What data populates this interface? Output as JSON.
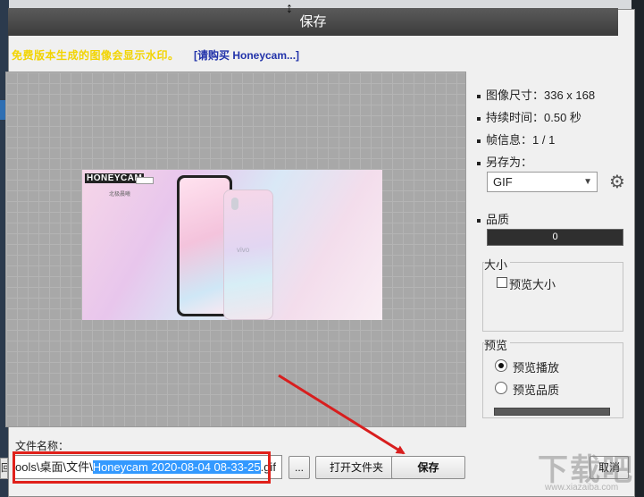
{
  "dialog": {
    "title": "保存",
    "notice": "免费版本生成的图像会显示水印。",
    "buy_link": "[请购买 Honeycam...]"
  },
  "preview": {
    "gif_logo": "HONEYCAM",
    "gif_subtitle": "北极晨曦",
    "phone_brand": "vivo"
  },
  "info": {
    "image_size": "图像尺寸：336 x 168",
    "duration": "持续时间：0.50 秒",
    "frame_info": "帧信息：1 / 1",
    "save_as_label": "另存为：",
    "format_value": "GIF",
    "quality_label": "品质",
    "quality_value": "0"
  },
  "size_group": {
    "title": "大小",
    "preview_size_label": "预览大小",
    "preview_size_checked": false
  },
  "preview_group": {
    "title": "预览",
    "play_label": "预览播放",
    "quality_label": "预览品质",
    "selected": "play"
  },
  "bottom": {
    "filename_label": "文件名称：",
    "path_prefix": "ools\\桌面\\文件\\",
    "path_selected": "Honeycam 2020-08-04 08-33-25",
    "path_suffix": ".gif",
    "browse_label": "...",
    "open_folder_label": "打开文件夹",
    "save_label": "保存",
    "cancel_label": "取消",
    "left_stub": "回"
  },
  "watermark": {
    "main": "下载吧",
    "sub": "www.xiazaiba.com"
  },
  "colors": {
    "notice": "#f2d400",
    "link": "#2233aa",
    "highlight_box": "#e0201a",
    "arrow": "#d81e1e",
    "selection": "#3399ff"
  }
}
